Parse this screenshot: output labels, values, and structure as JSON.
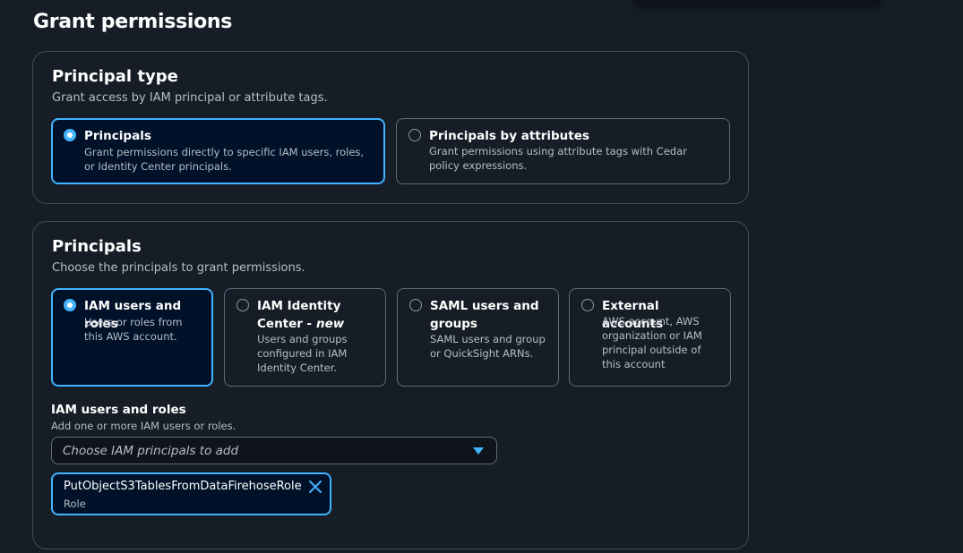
{
  "page": {
    "title": "Grant permissions"
  },
  "principal_type": {
    "title": "Principal type",
    "description": "Grant access by IAM principal or attribute tags.",
    "options": [
      {
        "label": "Principals",
        "description": "Grant permissions directly to specific IAM users, roles, or Identity Center principals.",
        "selected": true
      },
      {
        "label": "Principals by attributes",
        "description": "Grant permissions using attribute tags with Cedar policy expressions.",
        "selected": false
      }
    ]
  },
  "principals": {
    "title": "Principals",
    "description": "Choose the principals to grant permissions.",
    "options": [
      {
        "label": "IAM users and roles",
        "description": "Users or roles from this AWS account.",
        "selected": true
      },
      {
        "label": "IAM Identity Center",
        "label_suffix": "- new",
        "description": "Users and groups configured in IAM Identity Center.",
        "selected": false
      },
      {
        "label": "SAML users and groups",
        "description": "SAML users and group or QuickSight ARNs.",
        "selected": false
      },
      {
        "label": "External accounts",
        "description": "AWS account, AWS organization or IAM principal outside of this account",
        "selected": false
      }
    ],
    "field": {
      "label": "IAM users and roles",
      "description": "Add one or more IAM users or roles.",
      "placeholder": "Choose IAM principals to add"
    },
    "tokens": [
      {
        "name": "PutObjectS3TablesFromDataFirehoseRole",
        "type": "Role"
      }
    ]
  },
  "colors": {
    "accent": "#42b4ff",
    "background": "#161d26",
    "selected_bg": "#001129"
  }
}
